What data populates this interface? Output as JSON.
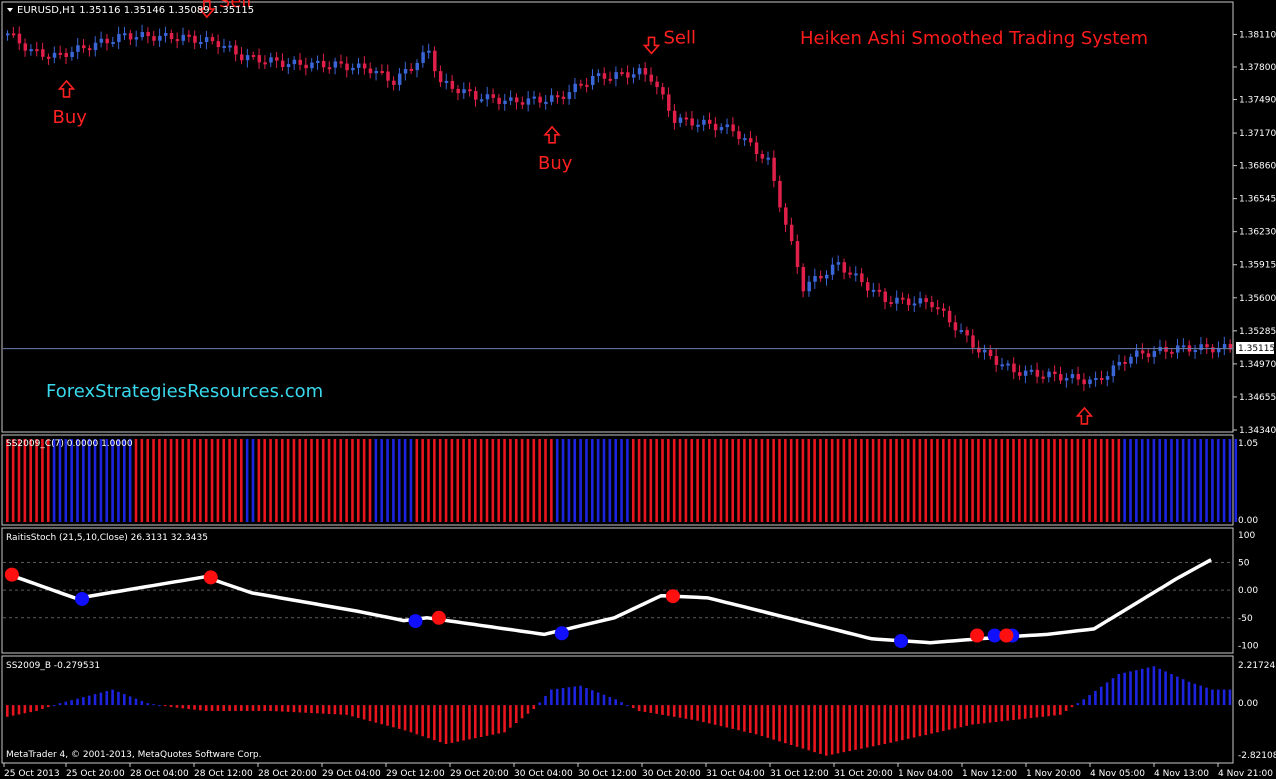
{
  "chart_data": [
    {
      "type": "candlestick",
      "header": "EURUSD,H1  1.35116 1.35146 1.35089 1.35115",
      "title": "Heiken Ashi Smoothed Trading System",
      "watermark": "ForexStrategiesResources.com",
      "current_price": "1.35115",
      "ylim": [
        1.3434,
        1.384
      ],
      "y_ticks": [
        "1.38110",
        "1.37800",
        "1.37490",
        "1.37170",
        "1.36860",
        "1.36545",
        "1.36230",
        "1.35915",
        "1.35600",
        "1.35285",
        "1.34970",
        "1.34655",
        "1.34340"
      ],
      "x_ticks": [
        "25 Oct 2013",
        "25 Oct 20:00",
        "28 Oct 04:00",
        "28 Oct 12:00",
        "28 Oct 20:00",
        "29 Oct 04:00",
        "29 Oct 12:00",
        "29 Oct 20:00",
        "30 Oct 04:00",
        "30 Oct 12:00",
        "30 Oct 20:00",
        "31 Oct 04:00",
        "31 Oct 12:00",
        "31 Oct 20:00",
        "1 Nov 04:00",
        "1 Nov 12:00",
        "1 Nov 20:00",
        "4 Nov 05:00",
        "4 Nov 13:00",
        "4 Nov 21:00"
      ],
      "signals": [
        {
          "label": "Buy",
          "bar": 10,
          "side": "buy"
        },
        {
          "label": "Sell",
          "bar": 34,
          "side": "sell"
        },
        {
          "label": "Buy",
          "bar": 93,
          "side": "buy"
        },
        {
          "label": "Sell",
          "bar": 110,
          "side": "sell"
        },
        {
          "label": "Buy",
          "bar": 184,
          "side": "buy"
        }
      ],
      "bull_color": "#3a66d8",
      "bear_color": "#e0204a"
    },
    {
      "type": "bar",
      "name": "SS2009_C(7) 0.0000 1.0000",
      "y_ticks": [
        "1.05",
        "0.00"
      ],
      "runs": [
        {
          "color": "red",
          "bars": 8
        },
        {
          "color": "blue",
          "bars": 14
        },
        {
          "color": "red",
          "bars": 19
        },
        {
          "color": "blue",
          "bars": 2
        },
        {
          "color": "red",
          "bars": 20
        },
        {
          "color": "blue",
          "bars": 7
        },
        {
          "color": "red",
          "bars": 24
        },
        {
          "color": "blue",
          "bars": 13
        },
        {
          "color": "red",
          "bars": 84
        },
        {
          "color": "blue",
          "bars": 20
        }
      ]
    },
    {
      "type": "line",
      "name": "RaitisStoch (21,5,10,Close) 26.3131 32.3435",
      "y_ticks": [
        "100",
        "50",
        "0.00",
        "-50",
        "-100"
      ],
      "ylim": [
        -110,
        105
      ],
      "curve": [
        [
          0,
          30
        ],
        [
          12,
          -15
        ],
        [
          34,
          24
        ],
        [
          42,
          -5
        ],
        [
          60,
          -38
        ],
        [
          68,
          -55
        ],
        [
          72,
          -50
        ],
        [
          92,
          -80
        ],
        [
          104,
          -50
        ],
        [
          112,
          -10
        ],
        [
          120,
          -14
        ],
        [
          148,
          -88
        ],
        [
          158,
          -95
        ],
        [
          170,
          -85
        ],
        [
          178,
          -80
        ],
        [
          186,
          -70
        ],
        [
          200,
          20
        ],
        [
          206,
          55
        ]
      ],
      "dots": [
        {
          "bar": 1,
          "value": 28,
          "color": "red"
        },
        {
          "bar": 13,
          "value": -16,
          "color": "blue"
        },
        {
          "bar": 35,
          "value": 23,
          "color": "red"
        },
        {
          "bar": 70,
          "value": -56,
          "color": "blue"
        },
        {
          "bar": 74,
          "value": -50,
          "color": "red"
        },
        {
          "bar": 95,
          "value": -78,
          "color": "blue"
        },
        {
          "bar": 114,
          "value": -11,
          "color": "red"
        },
        {
          "bar": 153,
          "value": -92,
          "color": "blue"
        },
        {
          "bar": 166,
          "value": -82,
          "color": "red"
        },
        {
          "bar": 169,
          "value": -82,
          "color": "blue"
        },
        {
          "bar": 172,
          "value": -82,
          "color": "blue"
        },
        {
          "bar": 171,
          "value": -82,
          "color": "red"
        }
      ]
    },
    {
      "type": "bar",
      "name": "SS2009_B -0.279531",
      "y_ticks": [
        "2.217245",
        "0.00",
        "-2.821081"
      ],
      "ylim": [
        -2.821081,
        2.217245
      ],
      "keyframes": [
        [
          0,
          -0.6
        ],
        [
          5,
          -0.3
        ],
        [
          9,
          0.1
        ],
        [
          18,
          0.8
        ],
        [
          24,
          0.1
        ],
        [
          28,
          -0.1
        ],
        [
          34,
          -0.3
        ],
        [
          45,
          -0.3
        ],
        [
          58,
          -0.5
        ],
        [
          68,
          -1.3
        ],
        [
          75,
          -2.0
        ],
        [
          85,
          -1.4
        ],
        [
          90,
          -0.2
        ],
        [
          93,
          0.8
        ],
        [
          98,
          1.0
        ],
        [
          104,
          0.3
        ],
        [
          108,
          -0.3
        ],
        [
          118,
          -0.8
        ],
        [
          128,
          -1.5
        ],
        [
          140,
          -2.6
        ],
        [
          150,
          -2.0
        ],
        [
          165,
          -1.0
        ],
        [
          180,
          -0.5
        ],
        [
          184,
          0.3
        ],
        [
          190,
          1.6
        ],
        [
          196,
          2.0
        ],
        [
          202,
          1.2
        ],
        [
          206,
          0.8
        ]
      ]
    }
  ],
  "footer": "MetaTrader 4, © 2001-2013, MetaQuotes Software Corp."
}
